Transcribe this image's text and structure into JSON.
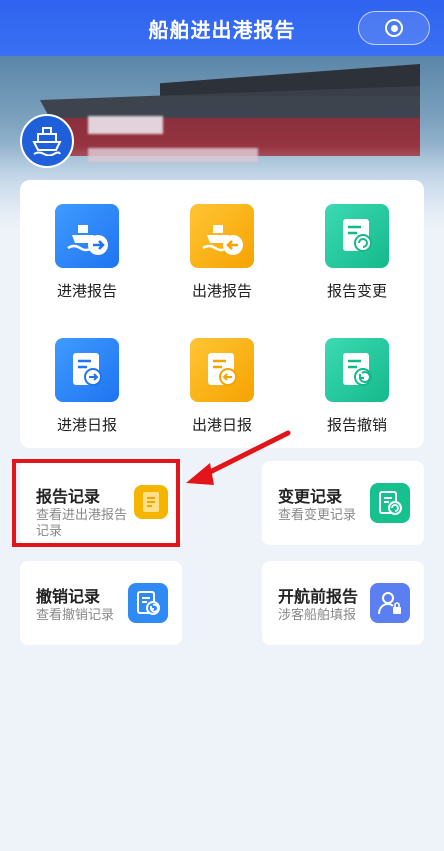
{
  "header": {
    "title": "船舶进出港报告"
  },
  "grid": {
    "items": [
      {
        "label": "进港报告",
        "icon": "ship-arrow-right-icon",
        "color": "blue"
      },
      {
        "label": "出港报告",
        "icon": "ship-arrow-left-icon",
        "color": "orange"
      },
      {
        "label": "报告变更",
        "icon": "document-refresh-icon",
        "color": "green"
      },
      {
        "label": "进港日报",
        "icon": "document-arrow-right-icon",
        "color": "blue"
      },
      {
        "label": "出港日报",
        "icon": "document-arrow-left-icon",
        "color": "orange"
      },
      {
        "label": "报告撤销",
        "icon": "document-undo-icon",
        "color": "green"
      }
    ]
  },
  "records": [
    {
      "title": "报告记录",
      "subtitle": "查看进出港报告记录",
      "icon": "document-list-icon",
      "color": "#f5b400"
    },
    {
      "title": "变更记录",
      "subtitle": "查看变更记录",
      "icon": "document-refresh-icon",
      "color": "#17c08f"
    },
    {
      "title": "撤销记录",
      "subtitle": "查看撤销记录",
      "icon": "document-undo-icon",
      "color": "#2f8af5"
    },
    {
      "title": "开航前报告",
      "subtitle": "涉客船舶填报",
      "icon": "person-lock-icon",
      "color": "#5b7ef0"
    }
  ],
  "colors": {
    "header": "#2f63f0",
    "highlight": "#e2151b"
  }
}
